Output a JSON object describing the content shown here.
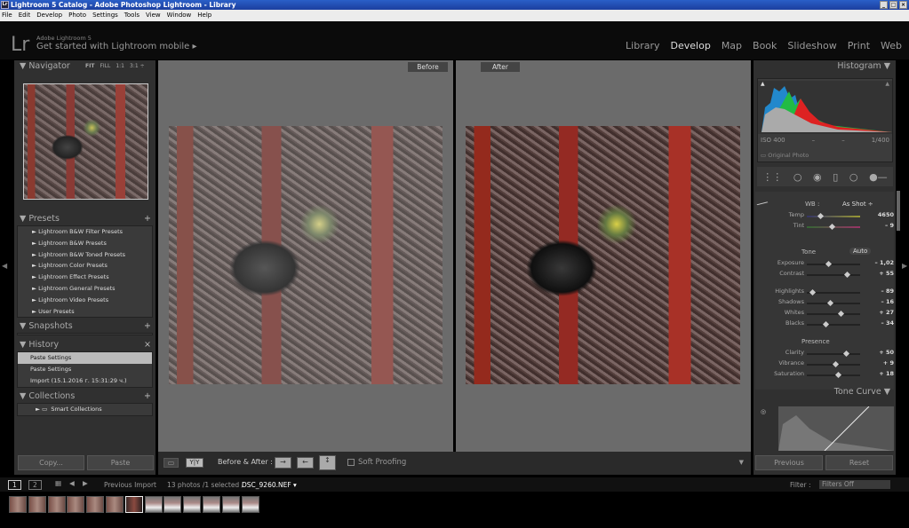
{
  "window": {
    "title": "Lightroom 5 Catalog - Adobe Photoshop Lightroom - Library",
    "icon": "Lr"
  },
  "menu": [
    "File",
    "Edit",
    "Develop",
    "Photo",
    "Settings",
    "Tools",
    "View",
    "Window",
    "Help"
  ],
  "header": {
    "logo": "Lr",
    "product": "Adobe Lightroom 5",
    "mobile": "Get started with Lightroom mobile ▸",
    "modules": [
      "Library",
      "Develop",
      "Map",
      "Book",
      "Slideshow",
      "Print",
      "Web"
    ],
    "active": "Develop"
  },
  "navigator": {
    "title": "Navigator",
    "zoom": [
      "FIT",
      "FILL",
      "1:1",
      "3:1 ÷"
    ]
  },
  "presets": {
    "title": "Presets",
    "items": [
      "Lightroom B&W Filter Presets",
      "Lightroom B&W Presets",
      "Lightroom B&W Toned Presets",
      "Lightroom Color Presets",
      "Lightroom Effect Presets",
      "Lightroom General Presets",
      "Lightroom Video Presets",
      "User Presets"
    ]
  },
  "snapshots": {
    "title": "Snapshots"
  },
  "history": {
    "title": "History",
    "items": [
      "Paste Settings",
      "Paste Settings",
      "Import (15.1.2016 г. 15:31:29 ч.)"
    ]
  },
  "collections": {
    "title": "Collections",
    "items": [
      "Smart Collections"
    ]
  },
  "left_buttons": {
    "copy": "Copy...",
    "paste": "Paste"
  },
  "view": {
    "before": "Before",
    "after": "After"
  },
  "toolbar": {
    "mode": "Y|Y",
    "before_after": "Before & After :",
    "soft_proofing": "Soft Proofing"
  },
  "histogram": {
    "title": "Histogram",
    "iso": "ISO 400",
    "f1": "–",
    "f2": "–",
    "shutter": "1/400",
    "original": "Original Photo"
  },
  "basic": {
    "wb_label": "WB :",
    "wb_value": "As Shot ÷",
    "tone": "Tone",
    "auto": "Auto",
    "presence": "Presence",
    "sliders": [
      {
        "label": "Temp",
        "value": "4650",
        "pos": 0.25
      },
      {
        "label": "Tint",
        "value": "– 9",
        "pos": 0.47
      },
      {
        "label": "Exposure",
        "value": "– 1,02",
        "pos": 0.4
      },
      {
        "label": "Contrast",
        "value": "+ 55",
        "pos": 0.75
      },
      {
        "label": "Highlights",
        "value": "– 89",
        "pos": 0.1
      },
      {
        "label": "Shadows",
        "value": "– 16",
        "pos": 0.43
      },
      {
        "label": "Whites",
        "value": "+ 27",
        "pos": 0.63
      },
      {
        "label": "Blacks",
        "value": "– 34",
        "pos": 0.35
      },
      {
        "label": "Clarity",
        "value": "+ 50",
        "pos": 0.73
      },
      {
        "label": "Vibrance",
        "value": "+ 9",
        "pos": 0.53
      },
      {
        "label": "Saturation",
        "value": "+ 18",
        "pos": 0.58
      }
    ]
  },
  "tone_curve": {
    "title": "Tone Curve"
  },
  "right_buttons": {
    "previous": "Previous",
    "reset": "Reset"
  },
  "filmstrip": {
    "view1": "1",
    "view2": "2",
    "source": "Previous Import",
    "count": "13 photos /1 selected /",
    "file": "DSC_9260.NEF ▾",
    "filter_label": "Filter :",
    "filter_value": "Filters Off",
    "thumb_count": 13,
    "selected_index": 6
  }
}
